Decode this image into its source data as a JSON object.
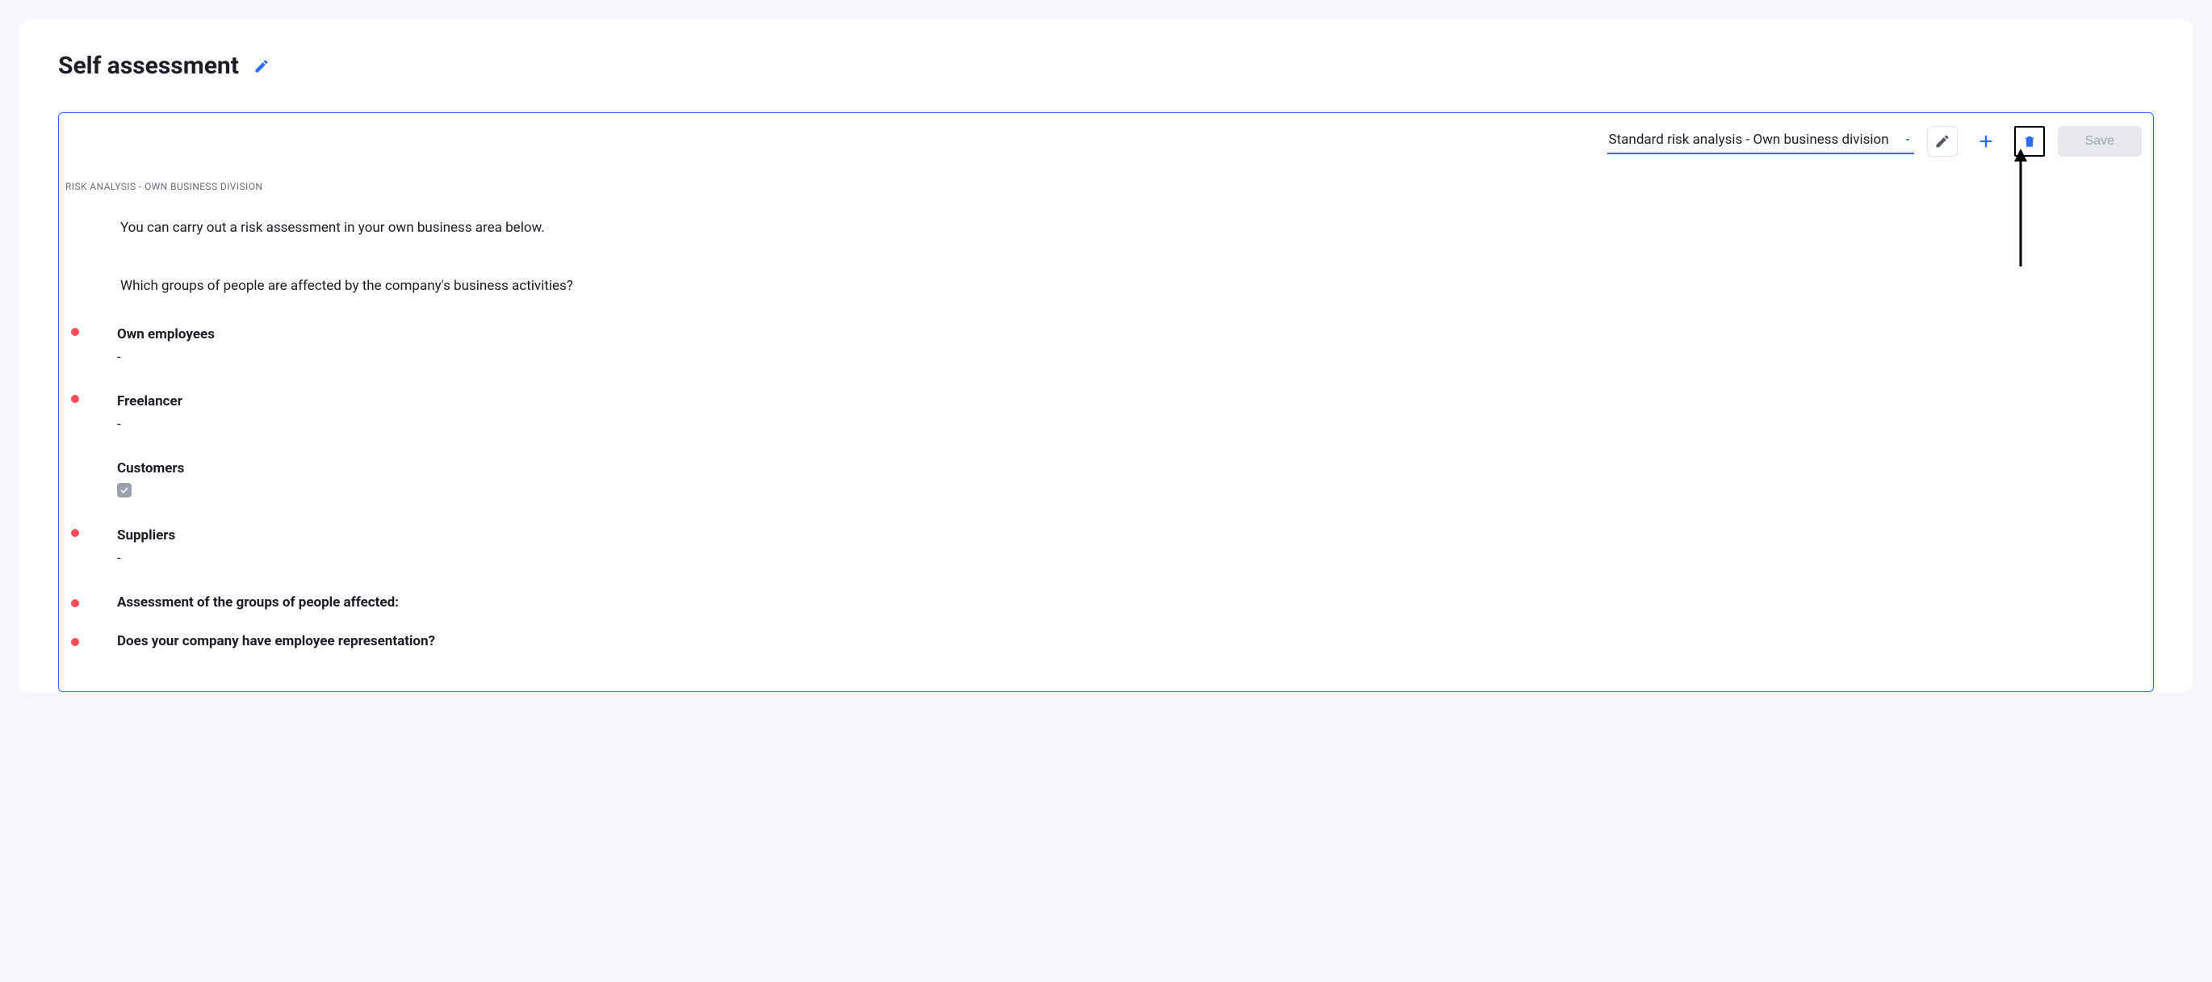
{
  "page": {
    "title": "Self assessment"
  },
  "toolbar": {
    "select_value": "Standard risk analysis - Own business division",
    "save_label": "Save"
  },
  "section": {
    "label": "RISK ANALYSIS - OWN BUSINESS DIVISION",
    "intro": "You can carry out a risk assessment in your own business area below.",
    "question": "Which groups of people are affected by the company's business activities?"
  },
  "groups": {
    "own_employees": {
      "title": "Own employees",
      "value": "-"
    },
    "freelancer": {
      "title": "Freelancer",
      "value": "-"
    },
    "customers": {
      "title": "Customers",
      "checked": true
    },
    "suppliers": {
      "title": "Suppliers",
      "value": "-"
    }
  },
  "extra": {
    "assessment_label": "Assessment of the groups of people affected:",
    "representation_question": "Does your company have employee representation?"
  }
}
